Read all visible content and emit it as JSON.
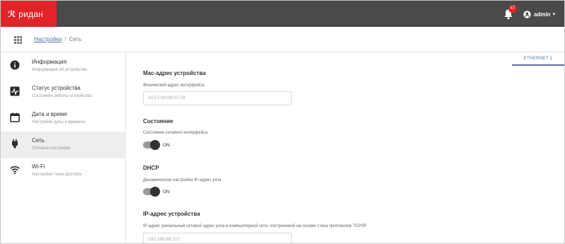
{
  "header": {
    "brand_mark": "ℛ",
    "brand_name": "ридан",
    "notification_count": "47",
    "user_name": "admin",
    "user_caret": "▾",
    "brand_color": "#e2232a",
    "bar_color": "#4a4a4a"
  },
  "breadcrumb": {
    "link": "Настройки",
    "separator": "/",
    "current": "Сеть"
  },
  "sidebar": {
    "items": [
      {
        "title": "Информация",
        "subtitle": "Информация об устройстве",
        "icon": "info-icon"
      },
      {
        "title": "Статус устройства",
        "subtitle": "Состояние работы устройства",
        "icon": "pulse-icon"
      },
      {
        "title": "Дата и время",
        "subtitle": "Настройки даты и времени",
        "icon": "calendar-icon"
      },
      {
        "title": "Сеть",
        "subtitle": "Сетевые настройки",
        "icon": "ethernet-plug-icon",
        "active": true
      },
      {
        "title": "Wi-Fi",
        "subtitle": "Настройки точки доступа",
        "icon": "wifi-icon"
      }
    ]
  },
  "tabs": {
    "active": "ETHERNET 1"
  },
  "main": {
    "mac": {
      "title": "Mac-адрес устройства",
      "label": "Физический адрес интерфейса",
      "value": "10:27:94:08:07:29"
    },
    "state": {
      "title": "Состояние",
      "label": "Состояние сетевого интерфейса",
      "toggle_text": "ON"
    },
    "dhcp": {
      "title": "DHCP",
      "label": "Динамическая настройка IP-адрес узла",
      "toggle_text": "ON"
    },
    "ip": {
      "title": "IP-адрес устройства",
      "label": "IP-адрес уникальный сетевой адрес узла в компьютерной сети, построенной на основе стека протоколов TCP/IP",
      "value": "192.168.88.217"
    }
  }
}
